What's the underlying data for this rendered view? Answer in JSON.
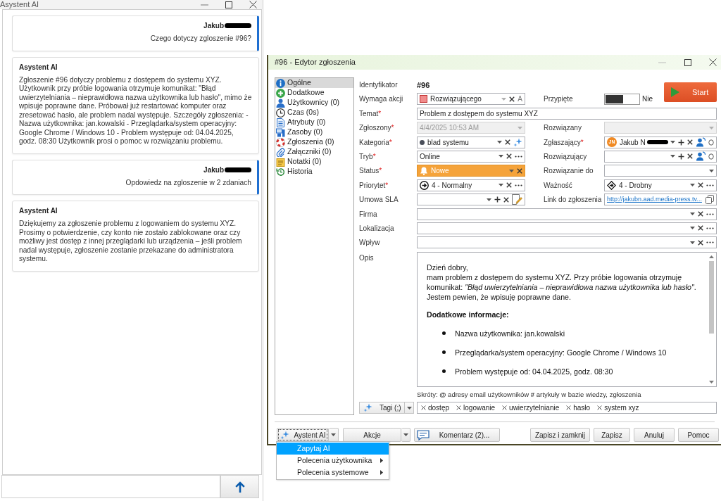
{
  "assistant_window": {
    "title": "Asystent AI",
    "messages": [
      {
        "kind": "user",
        "author": "Jakub",
        "redacted": true,
        "text": "Czego dotyczy zgloszenie #96?"
      },
      {
        "kind": "assistant",
        "author": "Asystent AI",
        "redacted": false,
        "text": "Zgłoszenie #96 dotyczy problemu z dostępem do systemu XYZ. Użytkownik przy próbie logowania otrzymuje komunikat: \"Błąd uwierzytelniania – nieprawidłowa nazwa użytkownika lub hasło\", mimo że wpisuje poprawne dane. Próbował już restartować komputer oraz zresetować hasło, ale problem nadal występuje. Szczegóły zgłoszenia: - Nazwa użytkownika: jan.kowalski - Przeglądarka/system operacyjny: Google Chrome / Windows 10 - Problem występuje od: 04.04.2025, godz. 08:30 Użytkownik prosi o pomoc w rozwiązaniu problemu."
      },
      {
        "kind": "user",
        "author": "Jakub",
        "redacted": true,
        "text": "Opdowiedz na zgloszenie w 2 zdaniach"
      },
      {
        "kind": "assistant",
        "author": "Asystent AI",
        "redacted": false,
        "text": "Dziękujemy za zgłoszenie problemu z logowaniem do systemu XYZ. Prosimy o potwierdzenie, czy konto nie zostało zablokowane oraz czy możliwy jest dostęp z innej przeglądarki lub urządzenia – jeśli problem nadal występuje, zgłoszenie zostanie przekazane do administratora systemu."
      }
    ]
  },
  "editor": {
    "title": "#96 - Edytor zgłoszenia",
    "nav": [
      {
        "label": "Ogólne",
        "selected": true
      },
      {
        "label": "Dodatkowe",
        "selected": false
      },
      {
        "label": "Użytkownicy (0)",
        "selected": false
      },
      {
        "label": "Czas (0s)",
        "selected": false
      },
      {
        "label": "Atrybuty (0)",
        "selected": false
      },
      {
        "label": "Zasoby (0)",
        "selected": false
      },
      {
        "label": "Zgłoszenia (0)",
        "selected": false
      },
      {
        "label": "Załączniki (0)",
        "selected": false
      },
      {
        "label": "Notatki (0)",
        "selected": false
      },
      {
        "label": "Historia",
        "selected": false
      }
    ],
    "start_button": {
      "label": "Start"
    },
    "rows": [
      {
        "left": {
          "label": "Identyfikator",
          "kind": "static",
          "value": "#96"
        }
      },
      {
        "left": {
          "label": "Wymaga akcji",
          "kind": "action",
          "value": "Rozwiązującego",
          "disabled": false,
          "suffix": "A"
        },
        "right": {
          "label": "Przypięte",
          "kind": "toggle",
          "on": false,
          "value": "Nie"
        }
      },
      {
        "wide": {
          "label": "Temat",
          "mark": "*",
          "kind": "text",
          "value": "Problem z dostępem do systemu XYZ",
          "disabled": false
        }
      },
      {
        "left": {
          "label": "Zgłoszony",
          "mark": "*",
          "kind": "date",
          "value": "4/4/2025 10:53 AM",
          "disabled": true
        },
        "right": {
          "label": "Rozwiązany",
          "kind": "date",
          "disabled": true
        }
      },
      {
        "left": {
          "label": "Kategoria",
          "mark": "*",
          "kind": "category",
          "value": "blad systemu",
          "disabled": false
        },
        "right": {
          "label": "Zgłaszający",
          "mark": "*",
          "kind": "person",
          "initials": "JN",
          "value": "Jakub N",
          "redacted": true,
          "disabled": false
        }
      },
      {
        "left": {
          "label": "Tryb",
          "mark": "*",
          "kind": "select",
          "value": "Online",
          "disabled": false
        },
        "right": {
          "label": "Rozwiązujący",
          "kind": "person",
          "disabled": false
        }
      },
      {
        "left": {
          "label": "Status",
          "mark": "*",
          "kind": "status",
          "value": "Nowe",
          "color": "#f5a33a",
          "disabled": false
        },
        "right": {
          "label": "Rozwiązanie do",
          "kind": "date",
          "disabled": false
        }
      },
      {
        "left": {
          "label": "Priorytet",
          "mark": "*",
          "kind": "priority",
          "value": "4 - Normalny",
          "disabled": false
        },
        "right": {
          "label": "Ważność",
          "kind": "severity",
          "value": "4 - Drobny",
          "disabled": false
        }
      },
      {
        "left": {
          "label": "Umowa SLA",
          "kind": "agreement",
          "disabled": false
        },
        "right": {
          "label": "Link do zgłoszenia",
          "kind": "link",
          "value": "http://jakubn.aad.media-press.tv...",
          "disabled": false
        }
      },
      {
        "wide": {
          "label": "Firma",
          "kind": "select",
          "disabled": false
        }
      },
      {
        "wide": {
          "label": "Lokalizacja",
          "kind": "select",
          "disabled": false
        }
      },
      {
        "wide": {
          "label": "Wpływ",
          "kind": "select",
          "disabled": false
        }
      }
    ],
    "description": {
      "label": "Opis",
      "greeting": "Dzień dobry,",
      "body": "mam problem z dostępem do systemu XYZ. Przy próbie logowania otrzymuję komunikat: *\"Błąd uwierzytelniania – nieprawidłowa nazwa użytkownika lub hasło\"*. Jestem pewien, że wpisuję poprawne dane.",
      "heading": "Dodatkowe informacje:",
      "bullets": [
        "Nazwa użytkownika: jan.kowalski",
        "Przeglądarka/system operacyjny: Google Chrome / Windows 10",
        "Problem występuje od: 04.04.2025, godz. 08:30"
      ]
    },
    "shortcuts_hint": "Skróty: **@** adresy email użytkowników **#** artykuły w bazie wiedzy, zgłoszenia",
    "tags_button": {
      "label": "Tagi (;)"
    },
    "tags": [
      "dostęp",
      "logowanie",
      "uwierzytelnianie",
      "hasło",
      "system xyz"
    ],
    "ai_button": {
      "label": "Aystent AI",
      "focused": true
    },
    "actions_button": {
      "label": "Akcje"
    },
    "comment_button": {
      "label": "Komentarz (2)..."
    },
    "buttons": [
      "Zapisz i zamknij",
      "Zapisz",
      "Anuluj",
      "Pomoc"
    ],
    "ai_menu": [
      {
        "label": "Zapytaj AI",
        "selected": true,
        "submenu": false
      },
      {
        "label": "Polecenia użytkownika",
        "selected": false,
        "submenu": true
      },
      {
        "label": "Polecenia systemowe",
        "selected": false,
        "submenu": true
      }
    ]
  }
}
